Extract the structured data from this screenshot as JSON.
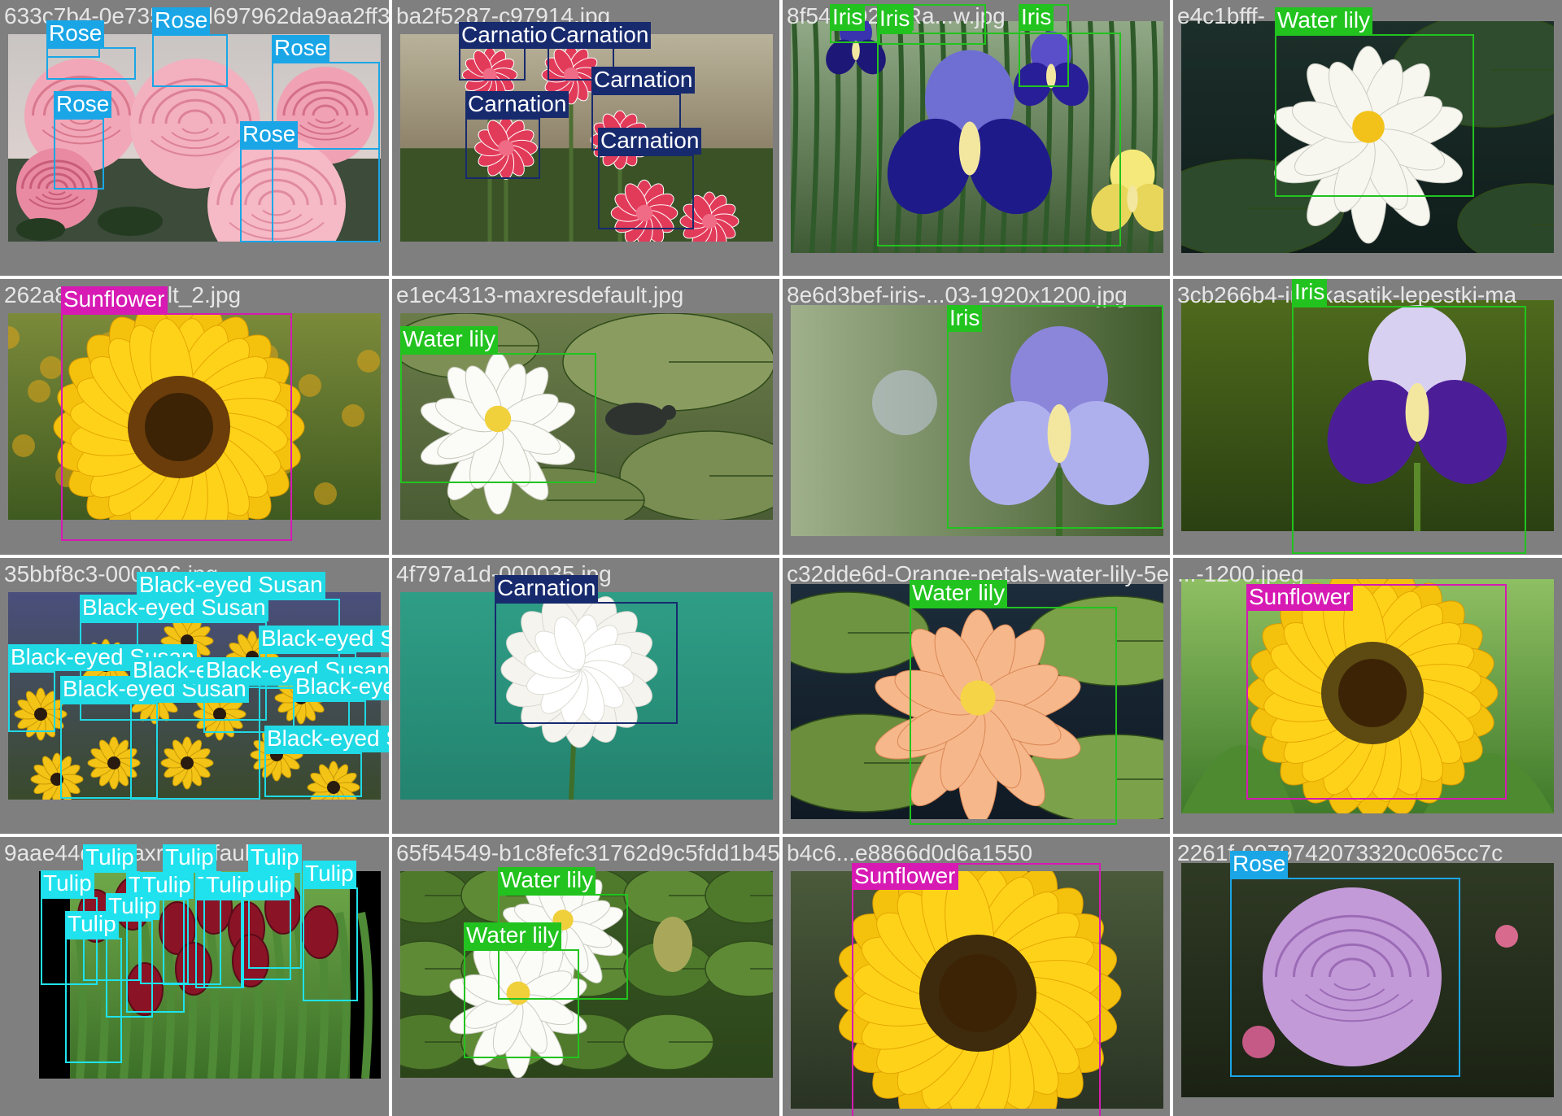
{
  "class_colors": {
    "Rose": "#1aa6e6",
    "Carnation": "#172a6e",
    "Iris": "#22c31f",
    "Water lily": "#22c31f",
    "Sunflower": "#d61ab3",
    "Black-eyed Susan": "#1fd9e4",
    "Tulip": "#1fe2ee"
  },
  "tiles": [
    {
      "filename": "633c7b4-0e73557dd697962da9aa2ff3...",
      "scene": "roses",
      "detections": [
        {
          "label": "Rose"
        },
        {
          "label": "Rose"
        },
        {
          "label": "Rose"
        },
        {
          "label": "Rose"
        },
        {
          "label": "Rose"
        },
        {
          "label": "Rose"
        }
      ]
    },
    {
      "filename": "ba2f5287-c97914.jpg",
      "scene": "carnations",
      "detections": [
        {
          "label": "Carnation"
        },
        {
          "label": "Carnation"
        },
        {
          "label": "Carnation"
        },
        {
          "label": "Carnation"
        },
        {
          "label": "Carnation"
        }
      ]
    },
    {
      "filename": "8f54...O2LTRa...w.jpg",
      "scene": "iris-garden",
      "detections": [
        {
          "label": "Iris"
        },
        {
          "label": "Iris"
        },
        {
          "label": "Iris"
        },
        {
          "label": "Iris"
        }
      ]
    },
    {
      "filename": "e4c1bfff-",
      "scene": "water-lily-dark",
      "detections": [
        {
          "label": "Water lily"
        }
      ]
    },
    {
      "filename": "262a8...esdefault_2.jpg",
      "scene": "sunflower-field",
      "detections": [
        {
          "label": "Sunflower"
        }
      ]
    },
    {
      "filename": "e1ec4313-maxresdefault.jpg",
      "scene": "water-lily-turtle",
      "detections": [
        {
          "label": "Water lily"
        }
      ]
    },
    {
      "filename": "8e6d3bef-iris-...03-1920x1200.jpg",
      "scene": "iris-lavender",
      "detections": [
        {
          "label": "Iris"
        }
      ]
    },
    {
      "filename": "3cb266b4-iris-kasatik-lepestki-ma",
      "scene": "iris-purple",
      "detections": [
        {
          "label": "Iris"
        }
      ]
    },
    {
      "filename": "35bbf8c3-000026.jpg",
      "scene": "black-eyed-susans",
      "detections": [
        {
          "label": "Black-eyed Susan"
        },
        {
          "label": "Black-eyed Susan"
        },
        {
          "label": "Black-eyed Susan"
        },
        {
          "label": "Black-eyed Susan"
        },
        {
          "label": "Black-eyed Susan"
        },
        {
          "label": "Black-eyed Susan"
        },
        {
          "label": "Black-eyed Susan"
        },
        {
          "label": "Black-eyed Susan"
        },
        {
          "label": "Black-eyed Susan"
        }
      ]
    },
    {
      "filename": "4f797a1d-000035.jpg",
      "scene": "white-carnation",
      "detections": [
        {
          "label": "Carnation"
        }
      ]
    },
    {
      "filename": "c32dde6d-Orange-petals-water-lily-5e04",
      "scene": "water-lily-orange",
      "detections": [
        {
          "label": "Water lily"
        }
      ]
    },
    {
      "filename": "...-1200.jpeg",
      "scene": "sunflower-close",
      "detections": [
        {
          "label": "Sunflower"
        }
      ]
    },
    {
      "filename": "9aae44d0-maxresdefault.jpg",
      "scene": "tulips",
      "detections": [
        {
          "label": "Tulip"
        },
        {
          "label": "Tulip"
        },
        {
          "label": "Tulip"
        },
        {
          "label": "Tulip"
        },
        {
          "label": "Tulip"
        },
        {
          "label": "Tulip"
        },
        {
          "label": "Tulip"
        },
        {
          "label": "Tulip"
        },
        {
          "label": "Tulip"
        },
        {
          "label": "Tulip"
        },
        {
          "label": "Tulip"
        },
        {
          "label": "Tulip"
        }
      ]
    },
    {
      "filename": "65f54549-b1c8fefc31762d9c5fdd1b456",
      "scene": "water-lilies-pads",
      "detections": [
        {
          "label": "Water lily"
        },
        {
          "label": "Water lily"
        }
      ]
    },
    {
      "filename": "b4c6...e8866d0d6a1550",
      "scene": "sunflower-dark",
      "detections": [
        {
          "label": "Sunflower"
        }
      ]
    },
    {
      "filename": "2261f-0979742073320c065cc7c",
      "scene": "rose-purple",
      "detections": [
        {
          "label": "Rose"
        }
      ]
    }
  ]
}
